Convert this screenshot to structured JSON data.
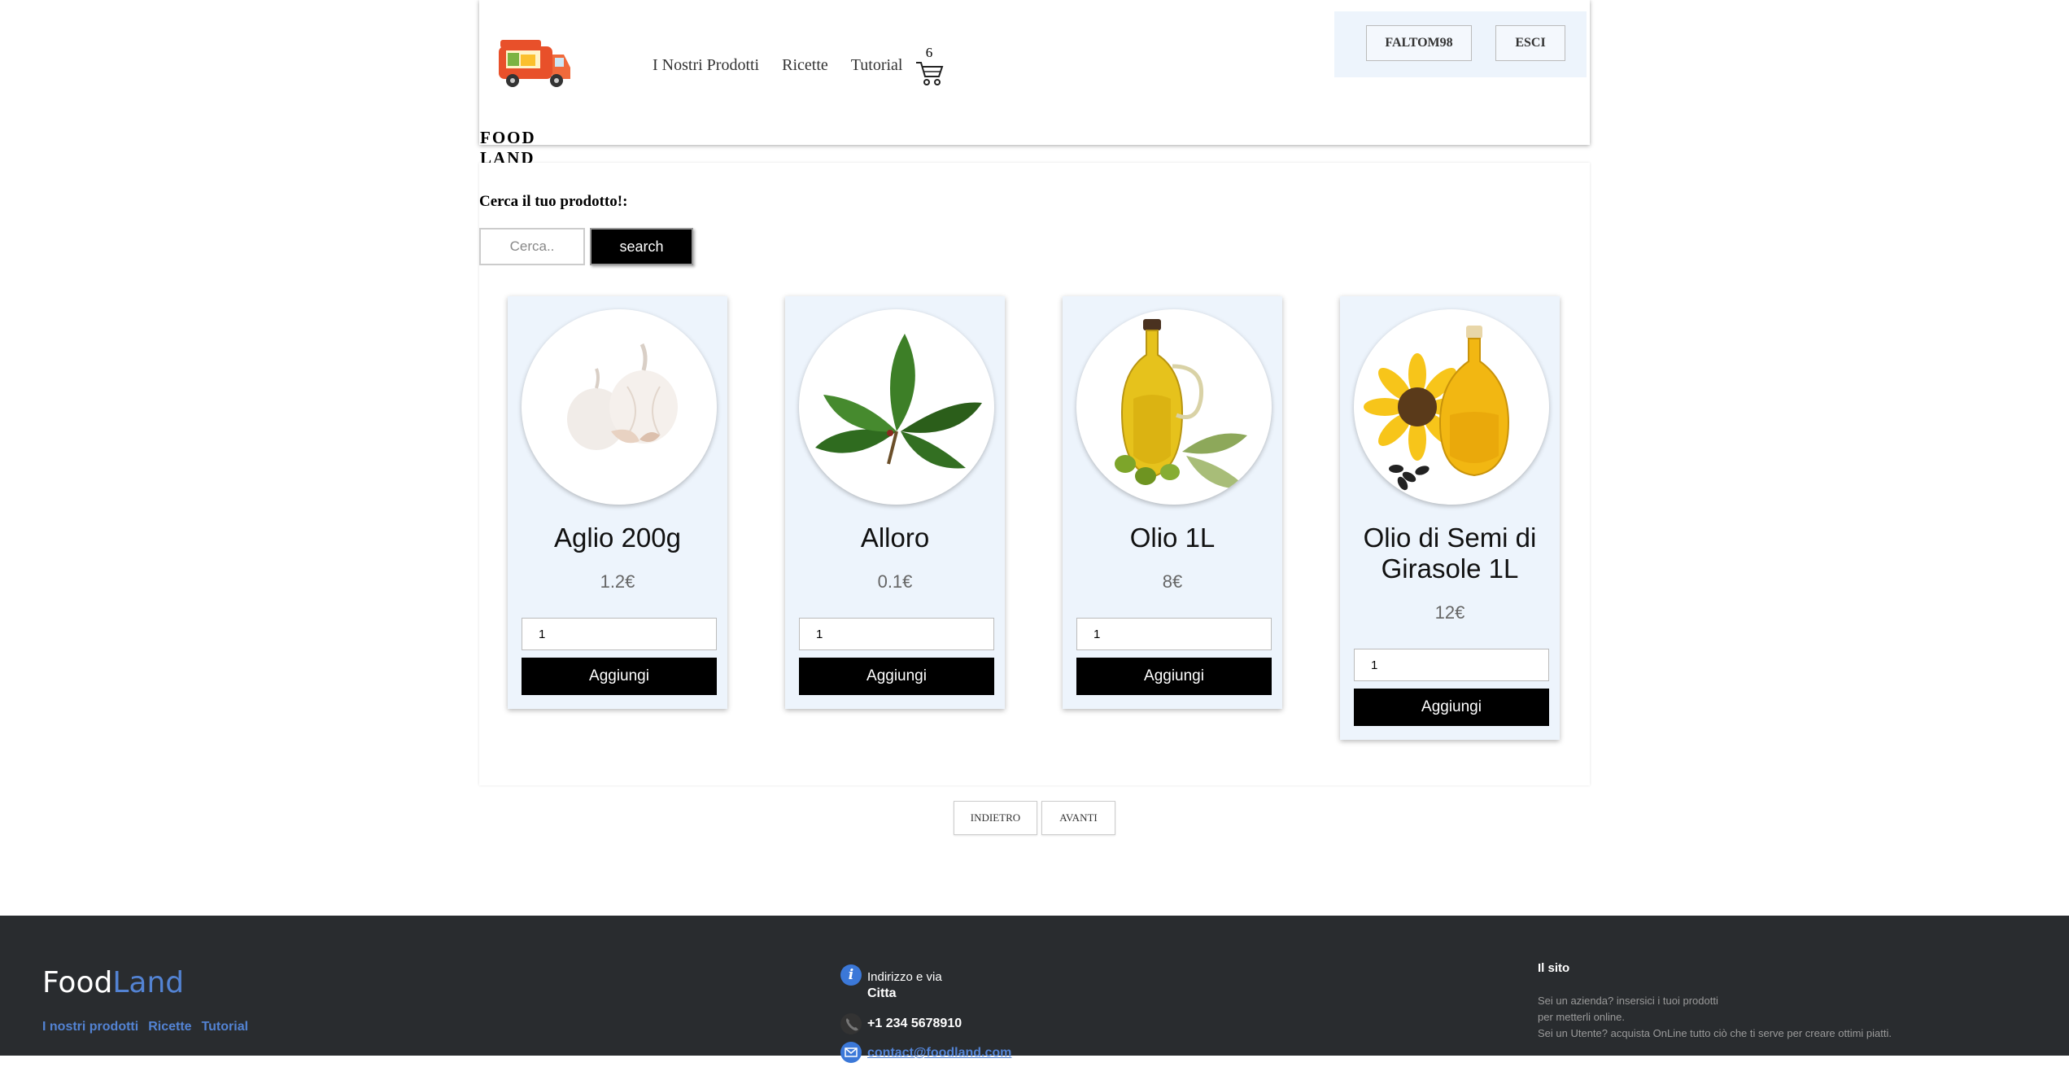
{
  "header": {
    "logo_text": "FOOD LAND",
    "nav": [
      "I Nostri Prodotti",
      "Ricette",
      "Tutorial"
    ],
    "cart_count": "6",
    "user_button": "FALTOM98",
    "logout_button": "ESCI"
  },
  "search": {
    "label": "Cerca il tuo prodotto!:",
    "placeholder": "Cerca..",
    "button": "search"
  },
  "products": [
    {
      "name": "Aglio 200g",
      "price": "1.2€",
      "qty": "1",
      "add_label": "Aggiungi",
      "image_icon": "garlic-icon"
    },
    {
      "name": "Alloro",
      "price": "0.1€",
      "qty": "1",
      "add_label": "Aggiungi",
      "image_icon": "bay-leaf-icon"
    },
    {
      "name": "Olio 1L",
      "price": "8€",
      "qty": "1",
      "add_label": "Aggiungi",
      "image_icon": "olive-oil-icon"
    },
    {
      "name": "Olio di Semi di Girasole 1L",
      "price": "12€",
      "qty": "1",
      "add_label": "Aggiungi",
      "image_icon": "sunflower-oil-icon"
    }
  ],
  "pagination": {
    "prev": "INDIETRO",
    "next": "AVANTI"
  },
  "footer": {
    "brand_part1": "Food",
    "brand_part2": "Land",
    "links": [
      "I nostri prodotti",
      "Ricette",
      "Tutorial"
    ],
    "address_line1": "Indirizzo e via",
    "address_line2": "Citta",
    "phone": "+1 234 5678910",
    "email": "contact@foodland.com",
    "about_title": "Il sito",
    "about_lines": [
      "Sei un azienda? insersici i tuoi prodotti",
      "per metterli online.",
      "Sei un Utente? acquista OnLine tutto ciò che ti serve per creare ottimi piatti."
    ]
  },
  "colors": {
    "accent": "#5383d3",
    "card_bg": "#edf4fc",
    "footer_bg": "#292c2f",
    "button_bg": "#000000"
  }
}
